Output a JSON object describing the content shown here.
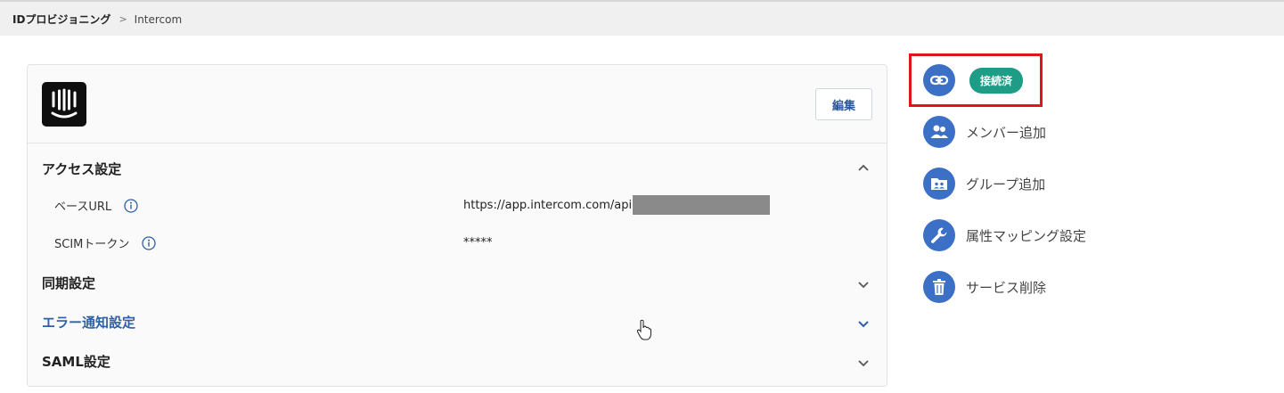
{
  "breadcrumb": {
    "root": "IDプロビジョニング",
    "separator": ">",
    "current": "Intercom"
  },
  "app": {
    "logo_icon": "intercom-logo-icon",
    "edit_label": "編集"
  },
  "access": {
    "title": "アクセス設定",
    "base_url_label": "ベースURL",
    "base_url_value": "https://app.intercom.com/api",
    "scim_token_label": "SCIMトークン",
    "scim_token_value": "*****"
  },
  "sections": {
    "sync": "同期設定",
    "error_notify": "エラー通知設定",
    "saml": "SAML設定"
  },
  "sidebar": {
    "status_badge": "接続済",
    "add_members": "メンバー追加",
    "add_groups": "グループ追加",
    "attribute_mapping": "属性マッピング設定",
    "delete_service": "サービス削除"
  },
  "colors": {
    "accent_blue": "#3c6fc6",
    "link_blue": "#2f5fa6",
    "badge_green": "#1f9c85",
    "highlight_red": "#e0141c"
  }
}
